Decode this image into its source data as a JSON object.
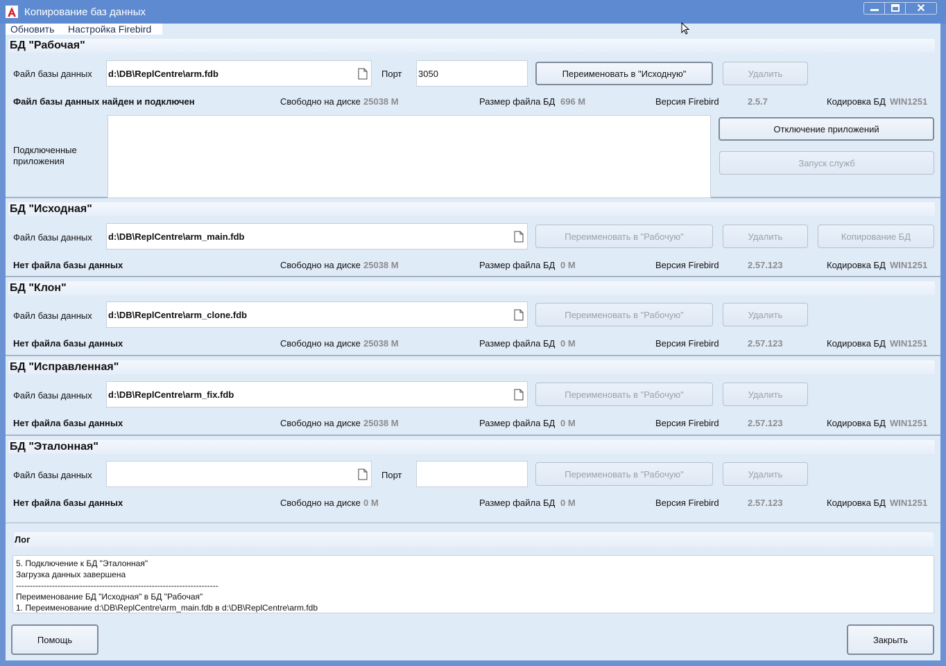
{
  "window": {
    "title": "Копирование баз данных",
    "min_icon": "minimize-icon",
    "max_icon": "maximize-icon",
    "close_label": "✕"
  },
  "menu": {
    "refresh": "Обновить",
    "settings": "Настройка Firebird"
  },
  "labels": {
    "file": "Файл базы данных",
    "port": "Порт",
    "free": "Свободно на диске",
    "size": "Размер файла",
    "db": "БД",
    "version": "Версия Firebird",
    "encoding": "Кодировка БД",
    "connected_apps": "Подключенные\nприложения"
  },
  "sections": [
    {
      "title": "БД \"Рабочая\"",
      "path": "d:\\DB\\ReplCentre\\arm.fdb",
      "port": "3050",
      "status": "Файл базы данных найден и подключен",
      "free": "25038 М",
      "size": "696 М",
      "version": "2.5.7",
      "encoding": "WIN1251",
      "rename_label": "Переименовать в \"Исходную\"",
      "delete_label": "Удалить",
      "disconnect_label": "Отключение приложений",
      "start_services_label": "Запуск служб"
    },
    {
      "title": "БД \"Исходная\"",
      "path": "d:\\DB\\ReplCentre\\arm_main.fdb",
      "status": "Нет файла базы данных",
      "free": "25038 М",
      "size": "0 М",
      "version": "2.57.123",
      "encoding": "WIN1251",
      "rename_label": "Переименовать в \"Рабочую\"",
      "delete_label": "Удалить",
      "copy_label": "Копирование БД"
    },
    {
      "title": "БД \"Клон\"",
      "path": "d:\\DB\\ReplCentre\\arm_clone.fdb",
      "status": "Нет файла базы данных",
      "free": "25038 М",
      "size": "0 М",
      "version": "2.57.123",
      "encoding": "WIN1251",
      "rename_label": "Переименовать в \"Рабочую\"",
      "delete_label": "Удалить"
    },
    {
      "title": "БД \"Исправленная\"",
      "path": "d:\\DB\\ReplCentre\\arm_fix.fdb",
      "status": "Нет файла базы данных",
      "free": "25038 М",
      "size": "0 М",
      "version": "2.57.123",
      "encoding": "WIN1251",
      "rename_label": "Переименовать в \"Рабочую\"",
      "delete_label": "Удалить"
    },
    {
      "title": "БД \"Эталонная\"",
      "path": "",
      "port": "",
      "status": "Нет файла базы данных",
      "free": "0 М",
      "size": "0 М",
      "version": "2.57.123",
      "encoding": "WIN1251",
      "rename_label": "Переименовать в \"Рабочую\"",
      "delete_label": "Удалить"
    }
  ],
  "log": {
    "title": "Лог",
    "text": "5. Подключение к БД \"Эталонная\"\nЗагрузка данных завершена\n-------------------------------------------------------------------------\nПереименование БД \"Исходная\" в БД \"Рабочая\"\n1. Переименование d:\\DB\\ReplCentre\\arm_main.fdb в d:\\DB\\ReplCentre\\arm.fdb"
  },
  "footer": {
    "help_label": "Помощь",
    "close_label": "Закрыть"
  }
}
